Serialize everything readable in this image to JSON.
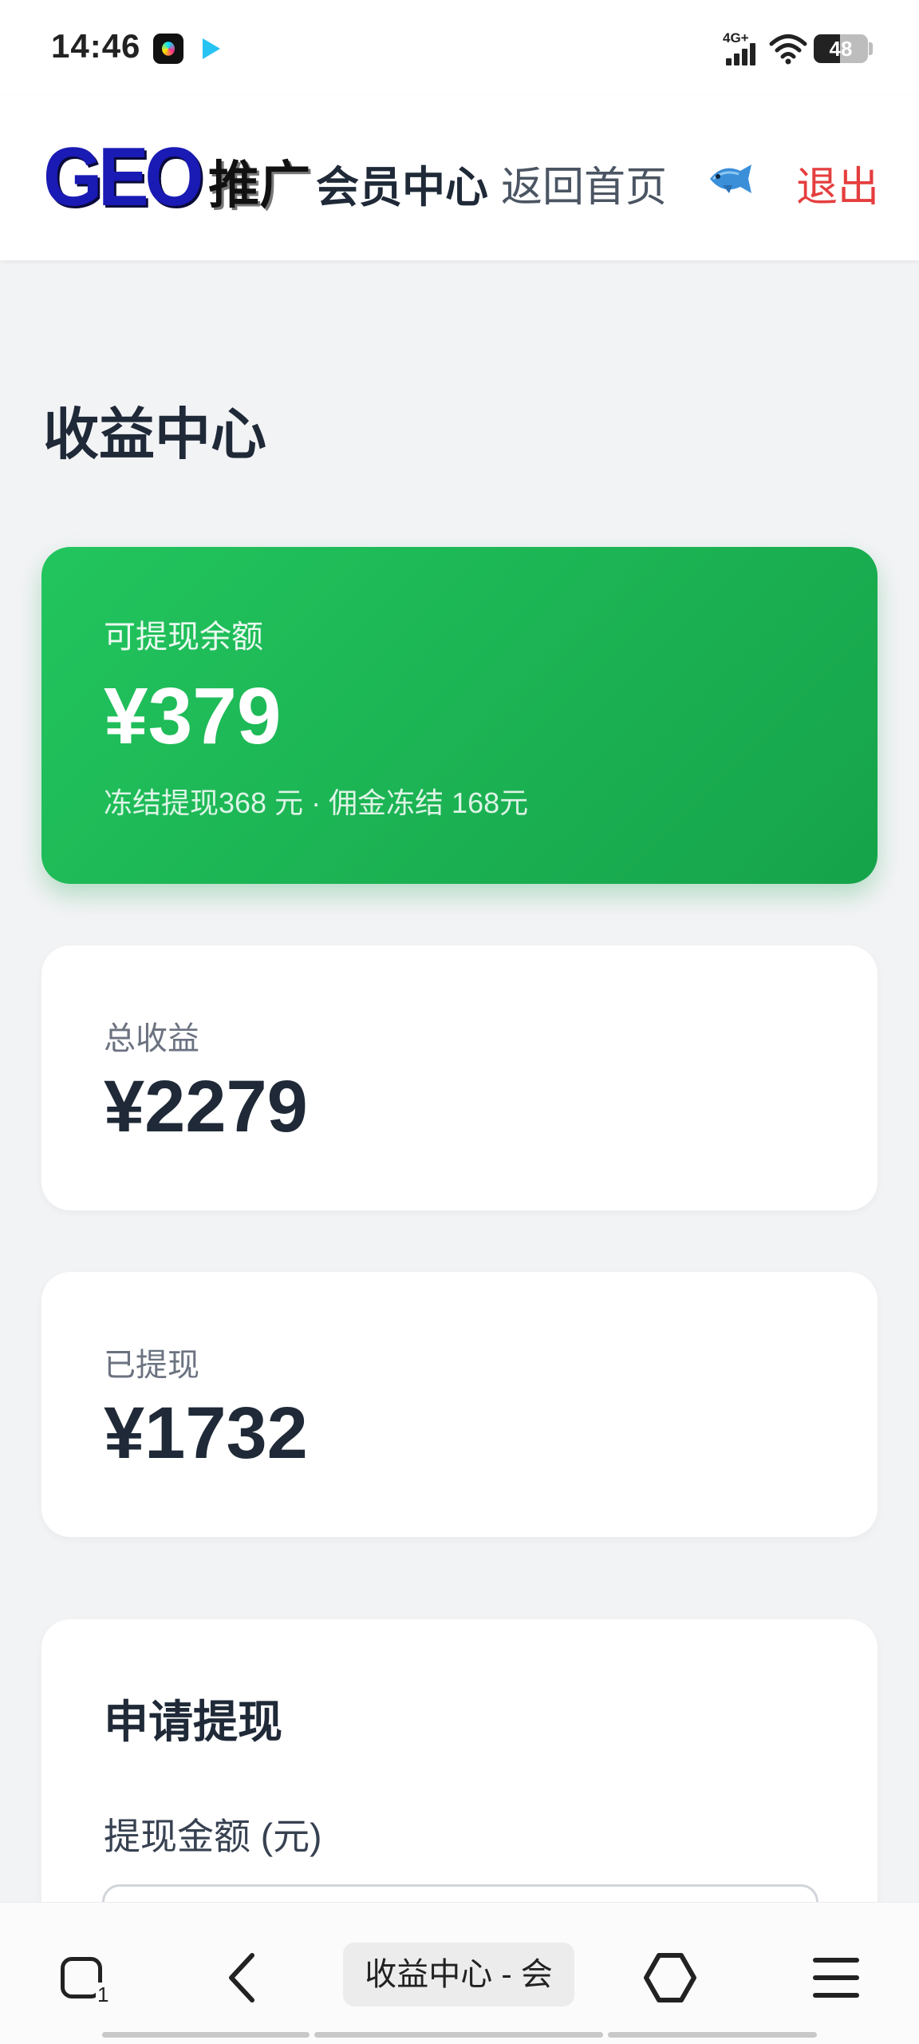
{
  "status_bar": {
    "time": "14:46",
    "signal_label": "4G+",
    "battery": {
      "text": "48",
      "level": 0.48
    },
    "icons": [
      "music-app-icon",
      "video-app-icon",
      "signal-icon",
      "wifi-icon",
      "battery-icon"
    ]
  },
  "header": {
    "logo_latin": "GEO",
    "logo_cjk": "推广",
    "title": "会员中心",
    "home_link": "返回首页",
    "avatar_icon": "fish-icon",
    "logout": "退出",
    "colors": {
      "logout": "#e53e3e",
      "logo_blue": "#1a1ab5"
    }
  },
  "page": {
    "title": "收益中心"
  },
  "balance_card": {
    "label": "可提现余额",
    "value": "¥379",
    "note": "冻结提现368 元 · 佣金冻结 168元",
    "color": "#22c55e"
  },
  "total_card": {
    "label": "总收益",
    "value": "¥2279"
  },
  "withdrawn_card": {
    "label": "已提现",
    "value": "¥1732"
  },
  "apply": {
    "title": "申请提现",
    "amount_label": "提现金额 (元)",
    "amount_value": ""
  },
  "browser_bar": {
    "tab_count": "1",
    "url_text": "收益中心 - 会",
    "icons": [
      "tabs-icon",
      "back-arrow-icon",
      "home-hexagon-icon",
      "menu-icon"
    ]
  }
}
